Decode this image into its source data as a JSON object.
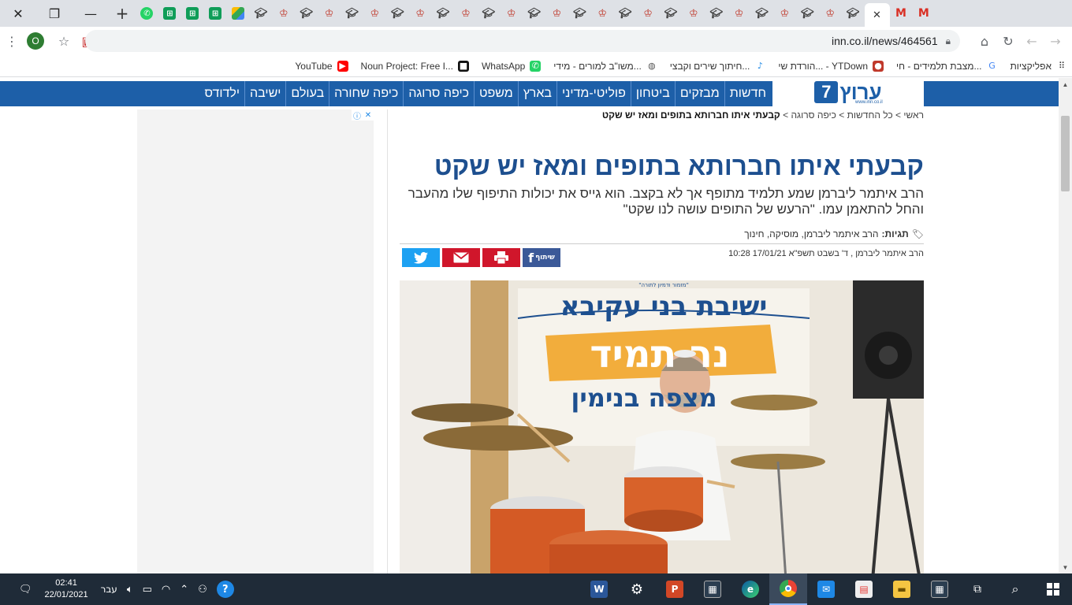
{
  "browser": {
    "window_controls": {
      "close": "✕",
      "restore": "❐",
      "minimize": "—"
    },
    "new_tab": "+",
    "active_tab_close": "✕",
    "tab_favicons": [
      "whatsapp-icon",
      "sheets-icon",
      "sheets-icon",
      "sheets-icon",
      "drive-icon",
      "cap-icon",
      "crest-icon",
      "cap-icon",
      "crest-icon",
      "cap-icon",
      "crest-icon",
      "cap-icon",
      "crest-icon",
      "cap-icon",
      "crest-icon",
      "cap-icon",
      "crest-icon",
      "cap-icon",
      "crest-icon",
      "cap-icon",
      "crest-icon",
      "cap-icon",
      "crest-icon",
      "cap-icon",
      "crest-icon",
      "cap-icon",
      "crest-icon",
      "cap-icon",
      "crest-icon",
      "cap-icon",
      "crest-icon",
      "cap-icon"
    ],
    "profile_initial": "O",
    "url": "inn.co.il/news/464561",
    "bookmarks": [
      {
        "label": "אפליקציות",
        "icon": "apps-grid-icon",
        "color": "#333333"
      },
      {
        "label": "מצבת תלמידים - חי...",
        "icon": "google-icon",
        "color": "#4285f4"
      },
      {
        "label": "הורדת שי... - YTDown",
        "icon": "ytdown-icon",
        "color": "#c0392b"
      },
      {
        "label": "חיתוך שירים וקבצי...",
        "icon": "music-note-icon",
        "color": "#1e88e5"
      },
      {
        "label": "משו\"ב למורים - מידי...",
        "icon": "globe-icon",
        "color": "#555555"
      },
      {
        "label": "WhatsApp",
        "icon": "whatsapp-icon",
        "color": "#25d366"
      },
      {
        "label": "Noun Project: Free I...",
        "icon": "noun-project-icon",
        "color": "#111111"
      },
      {
        "label": "YouTube",
        "icon": "youtube-icon",
        "color": "#ff0000"
      }
    ]
  },
  "site": {
    "logo_word": "ערוץ",
    "logo_number": "7",
    "logo_sub": "www.inn.co.il",
    "nav": [
      "חדשות",
      "מבזקים",
      "ביטחון",
      "פוליטי-מדיני",
      "בארץ",
      "משפט",
      "כיפה סרוגה",
      "כיפה שחורה",
      "בעולם",
      "ישיבה",
      "ילדודס"
    ]
  },
  "article": {
    "breadcrumb": [
      {
        "label": "ראשי"
      },
      {
        "label": "כל החדשות"
      },
      {
        "label": "כיפה סרוגה"
      },
      {
        "label": "קבעתי איתו חברותא בתופים ומאז יש שקט"
      }
    ],
    "title": "קבעתי איתו חברותא בתופים ומאז יש שקט",
    "subtitle": "הרב איתמר ליברמן שמע תלמיד מתופף אך לא בקצב. הוא גייס את יכולות התיפוף שלו מהעבר והחל להתאמן עמו. \"הרעש של התופים עושה לנו שקט\"",
    "tags_label": "תגיות:",
    "tags": "הרב איתמר ליברמן, מוסיקה, חינוך",
    "byline": "הרב איתמר ליברמן , ד' בשבט תשפ\"א 17/01/21 10:28",
    "share_label": "שיתוף"
  },
  "photo": {
    "banner_top": "ישיבת בני עקיבא",
    "banner_main": "נר תמיד",
    "banner_bottom": "מצפה בנימין",
    "banner_caption": "\"מזמור ודמיון לתורה\""
  },
  "taskbar": {
    "time": "02:41",
    "date": "22/01/2021",
    "language": "עבר"
  }
}
